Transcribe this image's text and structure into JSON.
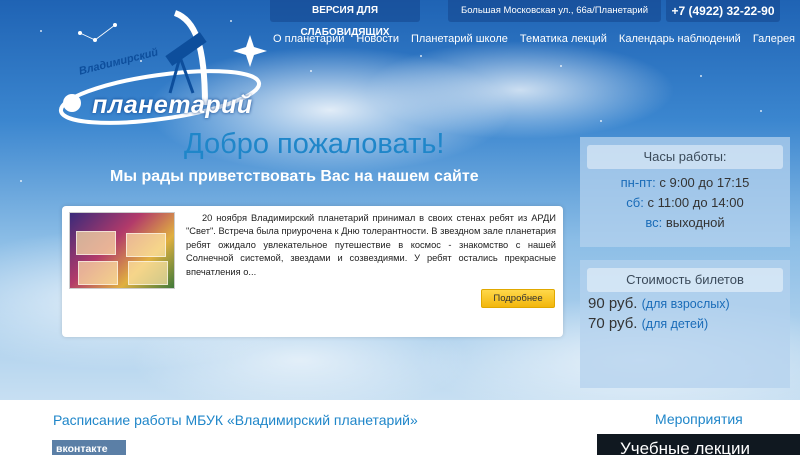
{
  "topbar": {
    "accessible_version": "ВЕРСИЯ ДЛЯ СЛАБОВИДЯЩИХ",
    "address": "Большая Московская ул., 66а/Планетарий",
    "phone": "+7 (4922) 32-22-90"
  },
  "logo": {
    "subtitle": "Владимирский",
    "title": "планетарий"
  },
  "nav": {
    "items": [
      {
        "label": "О планетарии"
      },
      {
        "label": "Новости"
      },
      {
        "label": "Планетарий школе"
      },
      {
        "label": "Тематика лекций"
      },
      {
        "label": "Календарь наблюдений"
      },
      {
        "label": "Галерея"
      }
    ]
  },
  "hero": {
    "title": "Добро пожаловать!",
    "subtitle": "Мы рады приветствовать Вас на нашем сайте"
  },
  "news": {
    "text": "20 ноября Владимирский планетарий принимал в своих стенах ребят из АРДИ \"Свет\". Встреча была приурочена к Дню толерантности. В звездном зале планетария ребят ожидало увлекательное путешествие в космос - знакомство с нашей Солнечной системой, звездами и созвездиями. У ребят остались прекрасные впечатления о...",
    "more_button": "Подробнее"
  },
  "hours": {
    "title": "Часы работы:",
    "rows": [
      {
        "days": "пн-пт:",
        "time": " с 9:00 до 17:15"
      },
      {
        "days": "сб:",
        "time": " с 11:00 до 14:00"
      },
      {
        "days": "вс:",
        "time": " выходной"
      }
    ]
  },
  "tickets": {
    "title": "Стоимость билетов",
    "rows": [
      {
        "price": "90 руб.",
        "note": "(для взрослых)"
      },
      {
        "price": "70 руб.",
        "note": "(для детей)"
      }
    ]
  },
  "schedule": {
    "title": "Расписание работы МБУК «Владимирский планетарий»",
    "vk_label": "вконтакте"
  },
  "events": {
    "title": "Мероприятия",
    "banner": "Учебные лекции"
  },
  "colors": {
    "accent": "#1f86c9",
    "button": "#f2b60c",
    "sky": "#3b86cf"
  }
}
